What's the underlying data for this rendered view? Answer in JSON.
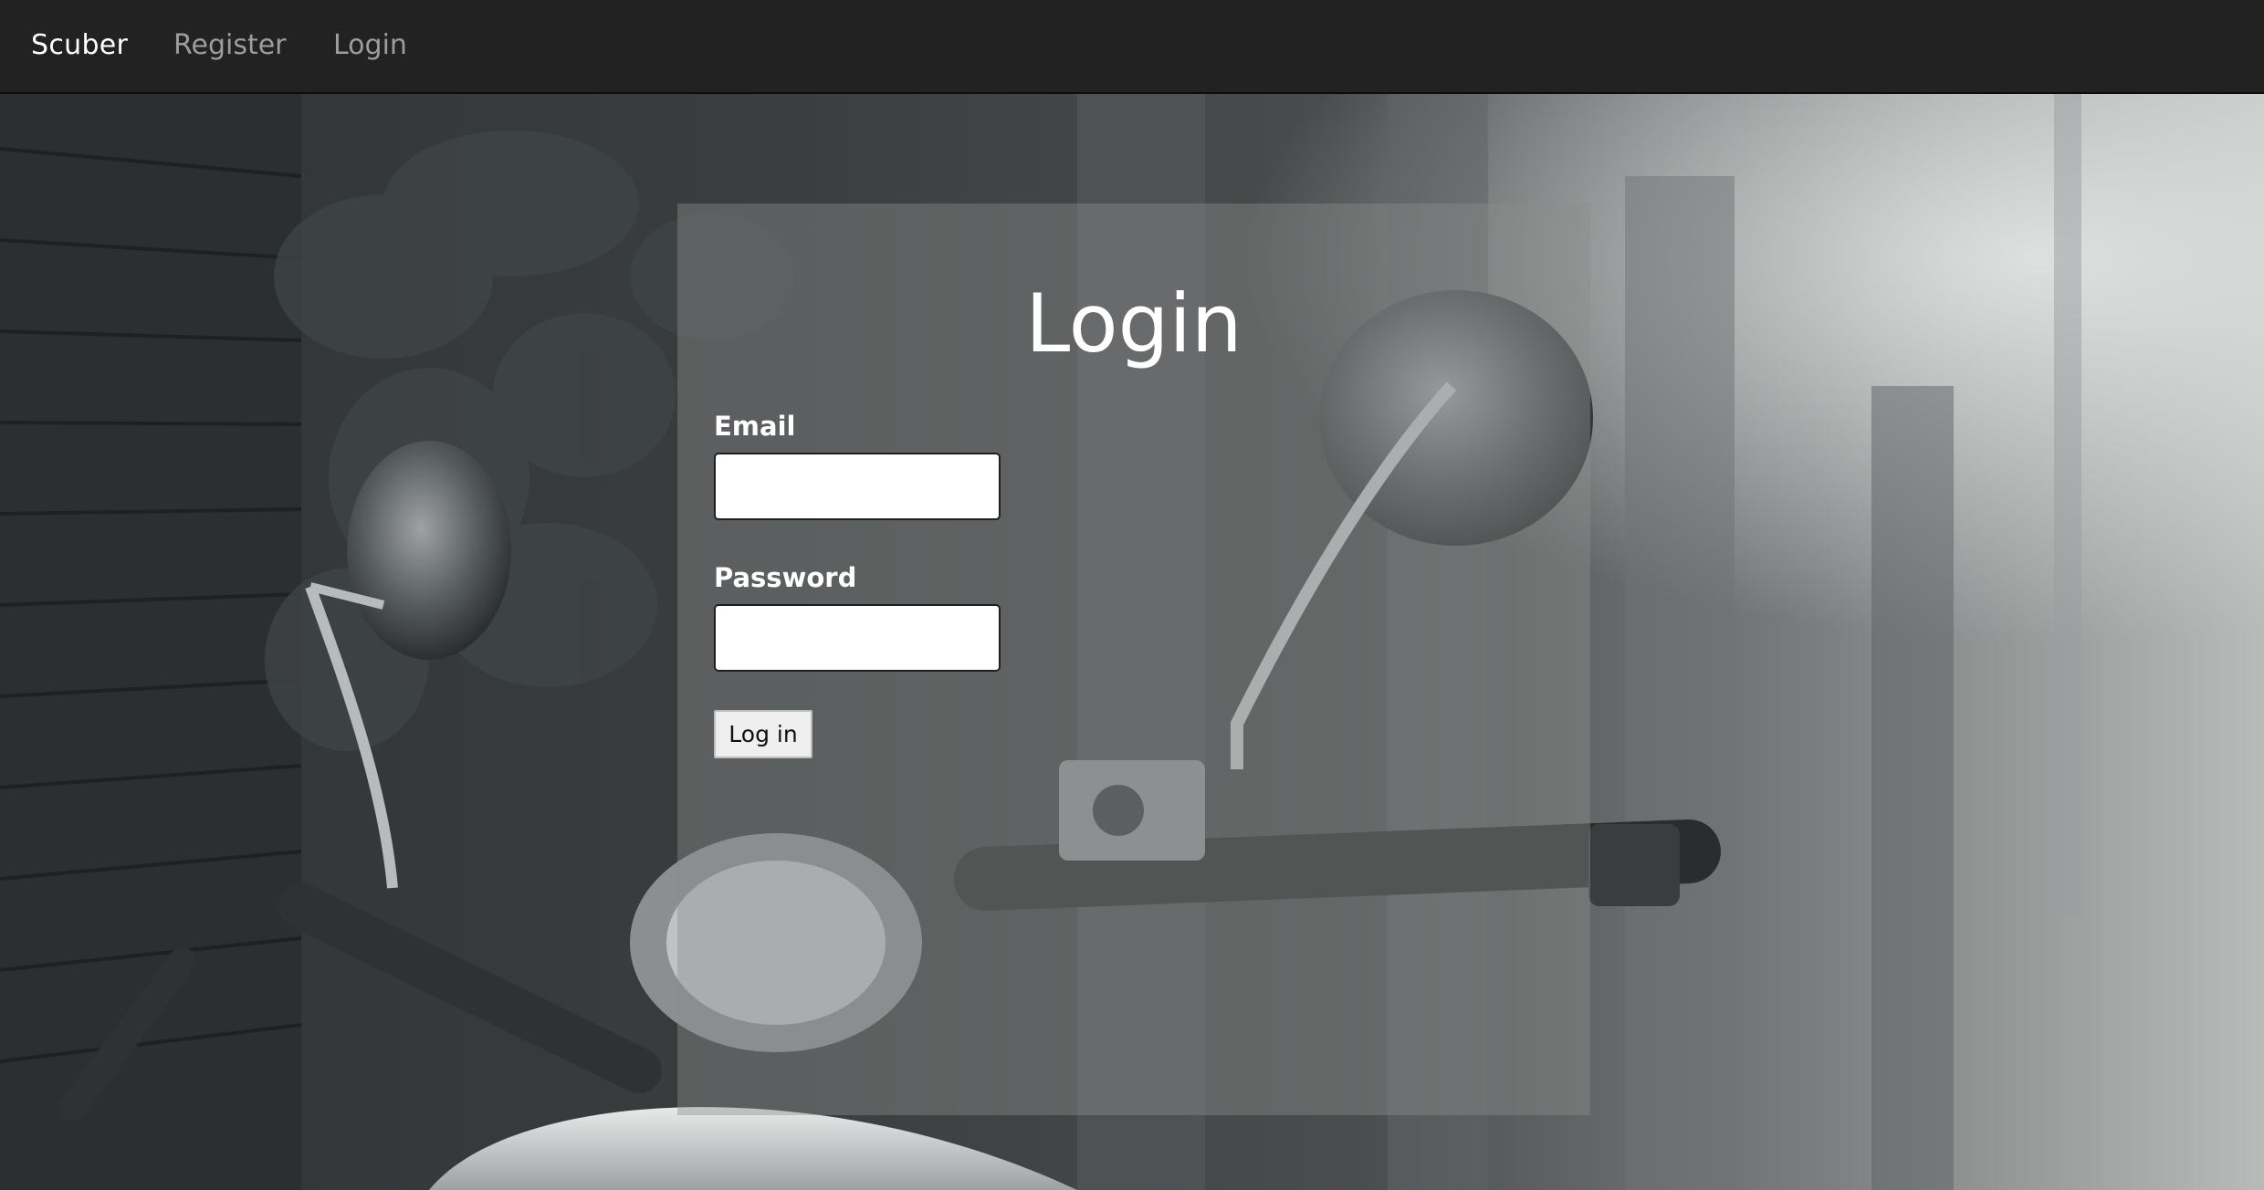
{
  "navbar": {
    "brand": "Scuber",
    "links": [
      {
        "label": "Register"
      },
      {
        "label": "Login"
      }
    ]
  },
  "login_form": {
    "title": "Login",
    "email_label": "Email",
    "email_value": "",
    "password_label": "Password",
    "password_value": "",
    "submit_label": "Log in"
  },
  "colors": {
    "navbar_bg": "#222222",
    "brand_text": "#ffffff",
    "nav_link_text": "#9d9d9d",
    "panel_overlay": "rgba(140,140,140,0.42)"
  }
}
